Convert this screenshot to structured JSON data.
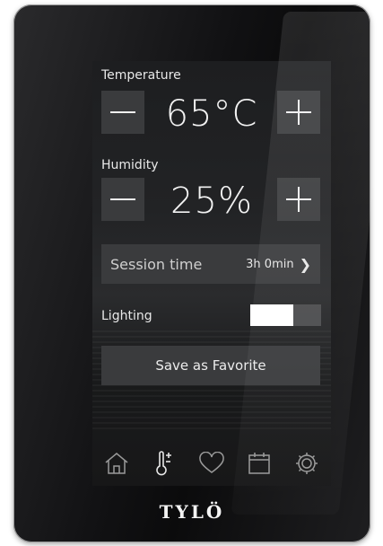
{
  "temperature": {
    "label": "Temperature",
    "value": "65°C"
  },
  "humidity": {
    "label": "Humidity",
    "value": "25%"
  },
  "session": {
    "label": "Session time",
    "value": "3h 0min",
    "chevron": "❯"
  },
  "lighting": {
    "label": "Lighting",
    "on": true
  },
  "favorite": {
    "button_label": "Save as Favorite"
  },
  "navbar": {
    "icons": [
      "home-icon",
      "thermometer-plus-icon",
      "heart-icon",
      "calendar-icon",
      "gear-icon"
    ]
  },
  "brand": {
    "logo": "TYLÖ"
  },
  "colors": {
    "button_bg": "#3a3b3d",
    "text": "#f2f2f2",
    "toggle_on": "#ffffff"
  }
}
